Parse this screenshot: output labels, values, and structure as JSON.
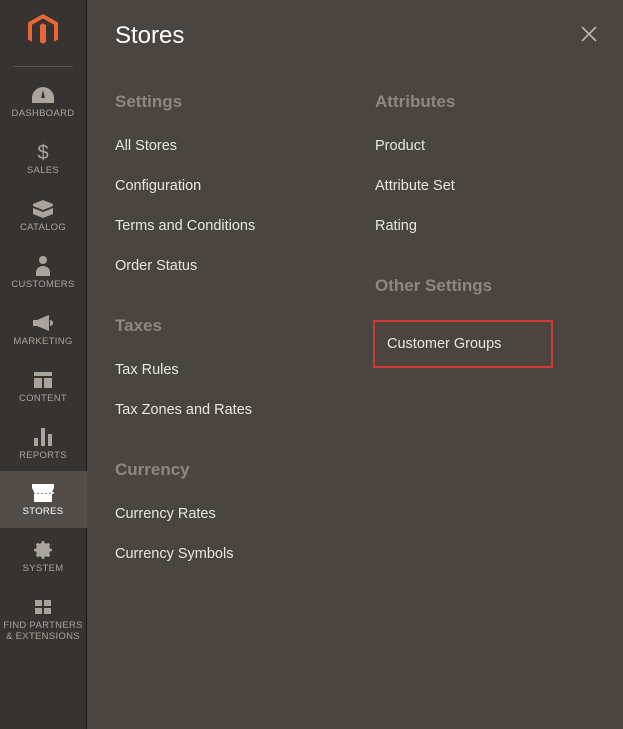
{
  "sidebar": {
    "items": [
      {
        "label": "DASHBOARD",
        "icon": "dashboard-icon"
      },
      {
        "label": "SALES",
        "icon": "dollar-icon"
      },
      {
        "label": "CATALOG",
        "icon": "box-icon"
      },
      {
        "label": "CUSTOMERS",
        "icon": "person-icon"
      },
      {
        "label": "MARKETING",
        "icon": "megaphone-icon"
      },
      {
        "label": "CONTENT",
        "icon": "layout-icon"
      },
      {
        "label": "REPORTS",
        "icon": "bars-icon"
      },
      {
        "label": "STORES",
        "icon": "storefront-icon"
      },
      {
        "label": "SYSTEM",
        "icon": "gear-icon"
      },
      {
        "label": "FIND PARTNERS\n& EXTENSIONS",
        "icon": "blocks-icon"
      }
    ],
    "active": "STORES"
  },
  "panel": {
    "title": "Stores",
    "columns": [
      {
        "sections": [
          {
            "title": "Settings",
            "items": [
              {
                "label": "All Stores"
              },
              {
                "label": "Configuration"
              },
              {
                "label": "Terms and Conditions"
              },
              {
                "label": "Order Status"
              }
            ]
          },
          {
            "title": "Taxes",
            "items": [
              {
                "label": "Tax Rules"
              },
              {
                "label": "Tax Zones and Rates"
              }
            ]
          },
          {
            "title": "Currency",
            "items": [
              {
                "label": "Currency Rates"
              },
              {
                "label": "Currency Symbols"
              }
            ]
          }
        ]
      },
      {
        "sections": [
          {
            "title": "Attributes",
            "items": [
              {
                "label": "Product"
              },
              {
                "label": "Attribute Set"
              },
              {
                "label": "Rating"
              }
            ]
          },
          {
            "title": "Other Settings",
            "items": [
              {
                "label": "Customer Groups",
                "highlighted": true
              }
            ]
          }
        ]
      }
    ]
  },
  "colors": {
    "accent": "#e74c3c",
    "highlight_border": "#d33a2f"
  }
}
